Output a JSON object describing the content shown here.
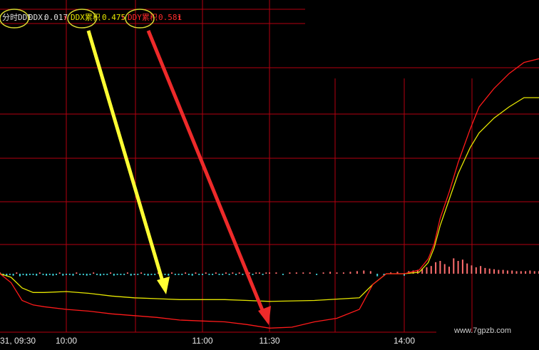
{
  "header": {
    "indicator_name": "分时DDE",
    "ddx_label": "DDX:",
    "ddx_value": "0.017",
    "ddx_arrow": "↑",
    "ddx_cum_label": "DDX累积",
    "ddx_cum_value": "0.475",
    "ddx_cum_arrow": "↑",
    "ddy_cum_label": "DDY累积",
    "ddy_cum_value": "0.581",
    "ddy_cum_arrow": "↑"
  },
  "x_axis": {
    "ticks": [
      {
        "label": "31, 09:30",
        "t": 0
      },
      {
        "label": "10:00",
        "t": 30
      },
      {
        "label": "11:00",
        "t": 90
      },
      {
        "label": "11:30",
        "t": 120
      },
      {
        "label": "14:00",
        "t": 150
      }
    ]
  },
  "watermark": "www.7gpzb.com",
  "colors": {
    "background": "#000000",
    "grid": "#b3000f",
    "ddx_cum_line": "#e6e600",
    "ddy_cum_line": "#ff1a1a",
    "bar_positive": "#ff6e6e",
    "bar_negative": "#40d8e0",
    "arrow_yellow": "#ffff33",
    "arrow_red": "#ee2a2a",
    "highlight_circle": "#d8d830"
  },
  "chart_data": {
    "type": "line",
    "title": "",
    "xlabel": "",
    "ylabel": "",
    "x_unit": "trading minutes since 09:30",
    "xlim": [
      0,
      195
    ],
    "ylim": [
      -0.05,
      0.55
    ],
    "grid": true,
    "legend": "header-top-left",
    "series": [
      {
        "name": "DDX累积",
        "color": "#e6e600",
        "x": [
          0,
          5,
          10,
          15,
          20,
          30,
          40,
          50,
          60,
          70,
          80,
          90,
          100,
          110,
          120,
          130,
          140,
          143,
          146,
          150,
          155,
          158,
          160,
          162,
          165,
          168,
          172,
          175,
          180,
          185,
          190,
          195
        ],
        "y": [
          0.0,
          -0.004,
          -0.016,
          -0.021,
          -0.021,
          -0.02,
          -0.022,
          -0.025,
          -0.027,
          -0.028,
          -0.029,
          -0.029,
          -0.029,
          -0.03,
          -0.031,
          -0.03,
          -0.027,
          -0.012,
          0.0,
          0.0,
          0.004,
          0.03,
          0.07,
          0.13,
          0.2,
          0.27,
          0.34,
          0.38,
          0.42,
          0.45,
          0.475,
          0.475
        ]
      },
      {
        "name": "DDY累积",
        "color": "#ff1a1a",
        "x": [
          0,
          5,
          10,
          15,
          20,
          30,
          40,
          50,
          60,
          70,
          80,
          90,
          100,
          110,
          120,
          125,
          130,
          135,
          140,
          143,
          146,
          150,
          155,
          158,
          160,
          162,
          165,
          168,
          172,
          175,
          180,
          185,
          190,
          195
        ],
        "y": [
          0.0,
          -0.01,
          -0.03,
          -0.035,
          -0.037,
          -0.04,
          -0.042,
          -0.045,
          -0.047,
          -0.049,
          -0.052,
          -0.053,
          -0.054,
          -0.057,
          -0.061,
          -0.06,
          -0.054,
          -0.05,
          -0.04,
          -0.012,
          0.0,
          0.0,
          0.01,
          0.04,
          0.08,
          0.15,
          0.22,
          0.3,
          0.39,
          0.45,
          0.5,
          0.54,
          0.57,
          0.58
        ]
      }
    ],
    "bars": {
      "name": "DDX",
      "x": [
        0,
        1.5,
        3,
        4.5,
        6,
        7.5,
        9,
        10.5,
        12,
        13.5,
        15,
        16.5,
        18,
        19.5,
        21,
        22.5,
        24,
        25.5,
        27,
        28.5,
        30,
        31.5,
        33,
        34.5,
        36,
        37.5,
        39,
        40.5,
        42,
        43.5,
        45,
        46.5,
        48,
        49.5,
        51,
        52.5,
        54,
        55.5,
        57,
        58.5,
        60,
        61.5,
        63,
        64.5,
        66,
        67.5,
        69,
        70.5,
        72,
        73.5,
        75,
        76.5,
        78,
        79.5,
        81,
        82.5,
        84,
        85.5,
        87,
        88.5,
        90,
        91.5,
        93,
        94.5,
        96,
        97.5,
        99,
        100.5,
        102,
        103.5,
        105,
        106.5,
        108,
        109.5,
        111,
        112.5,
        114,
        115.5,
        117,
        118.5,
        120,
        121.5,
        123,
        124.5,
        126,
        127.5,
        129,
        130.5,
        132,
        133.5,
        135,
        136.5,
        138,
        139.5,
        141,
        142.5,
        144,
        145.5,
        147,
        148.5,
        150,
        151.5,
        153,
        154.5,
        156,
        157.5,
        159,
        160.5,
        162,
        163.5,
        165,
        166.5,
        168,
        169.5,
        171,
        172.5,
        174,
        175.5,
        177,
        178.5,
        180,
        181.5,
        183,
        184.5,
        186,
        187.5,
        189,
        190.5,
        192,
        193.5,
        195
      ],
      "values": [
        0.002,
        -0.003,
        -0.004,
        -0.002,
        -0.003,
        0.002,
        -0.004,
        -0.002,
        -0.003,
        -0.002,
        -0.002,
        -0.003,
        0.002,
        -0.002,
        -0.003,
        -0.002,
        -0.003,
        -0.002,
        0.002,
        -0.003,
        -0.002,
        -0.002,
        -0.003,
        0.002,
        -0.002,
        -0.002,
        -0.003,
        -0.002,
        0.002,
        -0.002,
        -0.003,
        -0.002,
        -0.002,
        0.002,
        -0.003,
        -0.002,
        -0.002,
        -0.002,
        0.002,
        -0.003,
        -0.002,
        -0.002,
        0.002,
        -0.002,
        -0.003,
        -0.002,
        -0.002,
        0.002,
        -0.002,
        -0.002,
        -0.003,
        0.002,
        -0.002,
        -0.002,
        -0.002,
        0.002,
        -0.002,
        -0.003,
        0.002,
        -0.002,
        -0.002,
        0.002,
        -0.002,
        -0.002,
        0.002,
        -0.002,
        -0.002,
        0.002,
        -0.002,
        0.002,
        -0.002,
        0.002,
        -0.002,
        0.002,
        0.002,
        -0.002,
        0.002,
        0.002,
        -0.002,
        0.002,
        0.002,
        0.002,
        -0.002,
        0.002,
        0.002,
        0.002,
        0.002,
        -0.002,
        0.002,
        0.003,
        0.002,
        0.002,
        0.003,
        0.004,
        0.005,
        0.004,
        -0.004,
        -0.003,
        0.002,
        0.003,
        -0.003,
        0.004,
        0.005,
        0.006,
        0.008,
        0.01,
        0.012,
        0.018,
        0.02,
        0.015,
        0.011,
        0.024,
        0.02,
        0.022,
        0.016,
        0.013,
        0.01,
        0.012,
        0.009,
        0.008,
        0.007,
        0.006,
        0.006,
        0.005,
        0.005,
        0.004,
        0.004,
        0.004,
        0.005,
        0.004,
        0.004,
        0.003
      ]
    }
  }
}
